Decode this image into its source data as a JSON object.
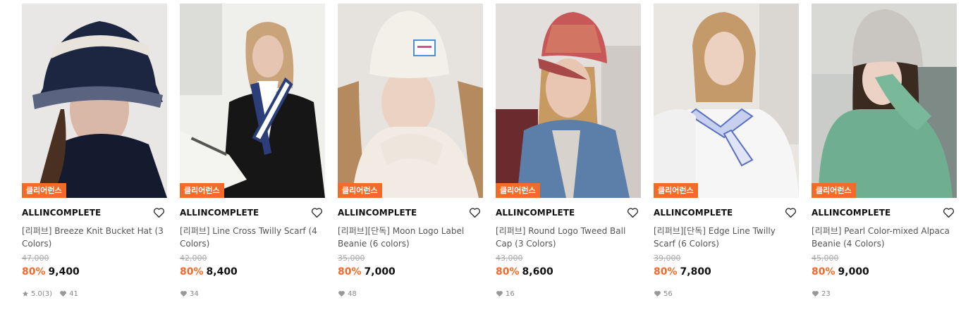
{
  "products": [
    {
      "tag": "클리어런스",
      "brand": "ALLINCOMPLETE",
      "name": "[리퍼브] Breeze Knit Bucket Hat (3 Colors)",
      "original_price": "47,000",
      "discount": "80%",
      "price": "9,400",
      "rating": "5.0",
      "review_count": "(3)",
      "likes": "41"
    },
    {
      "tag": "클리어런스",
      "brand": "ALLINCOMPLETE",
      "name": "[리퍼브] Line Cross Twilly Scarf (4 Colors)",
      "original_price": "42,000",
      "discount": "80%",
      "price": "8,400",
      "likes": "34"
    },
    {
      "tag": "클리어런스",
      "brand": "ALLINCOMPLETE",
      "name": "[리퍼브][단독] Moon Logo Label Beanie (6 colors)",
      "original_price": "35,000",
      "discount": "80%",
      "price": "7,000",
      "likes": "48"
    },
    {
      "tag": "클리어런스",
      "brand": "ALLINCOMPLETE",
      "name": "[리퍼브] Round Logo Tweed Ball Cap (3 Colors)",
      "original_price": "43,000",
      "discount": "80%",
      "price": "8,600",
      "likes": "16"
    },
    {
      "tag": "클리어런스",
      "brand": "ALLINCOMPLETE",
      "name": "[리퍼브][단독] Edge Line Twilly Scarf (6 Colors)",
      "original_price": "39,000",
      "discount": "80%",
      "price": "7,800",
      "likes": "56"
    },
    {
      "tag": "클리어런스",
      "brand": "ALLINCOMPLETE",
      "name": "[리퍼브] Pearl Color-mixed Alpaca Beanie (4 Colors)",
      "original_price": "45,000",
      "discount": "80%",
      "price": "9,000",
      "likes": "23"
    }
  ],
  "colors": {
    "accent": "#f26b2a",
    "text": "#111111",
    "muted": "#888888"
  }
}
